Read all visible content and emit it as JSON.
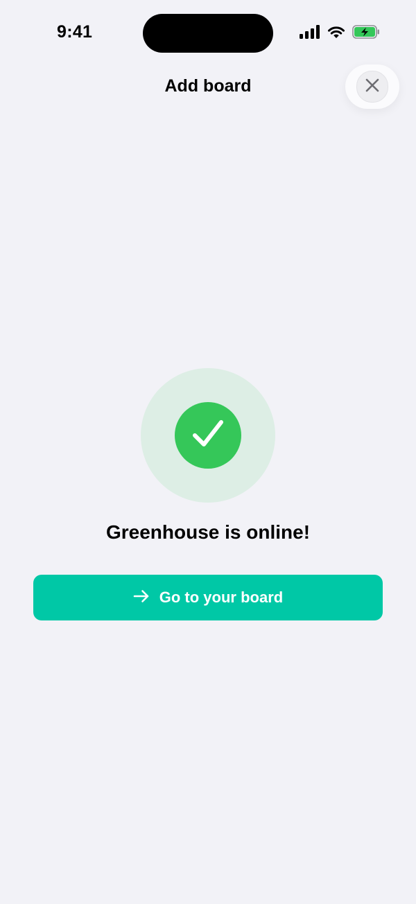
{
  "status_bar": {
    "time": "9:41"
  },
  "header": {
    "title": "Add board"
  },
  "success": {
    "message": "Greenhouse is online!"
  },
  "cta": {
    "label": "Go to your board"
  },
  "icons": {
    "close": "close-icon",
    "check": "checkmark-icon",
    "arrow": "arrow-right-icon",
    "signal": "cellular-signal-icon",
    "wifi": "wifi-icon",
    "battery": "battery-charging-icon"
  },
  "colors": {
    "background": "#F2F2F7",
    "success_green": "#35C759",
    "success_halo": "#DDEEE5",
    "cta_teal": "#00C8A6",
    "battery_green": "#34C759"
  }
}
